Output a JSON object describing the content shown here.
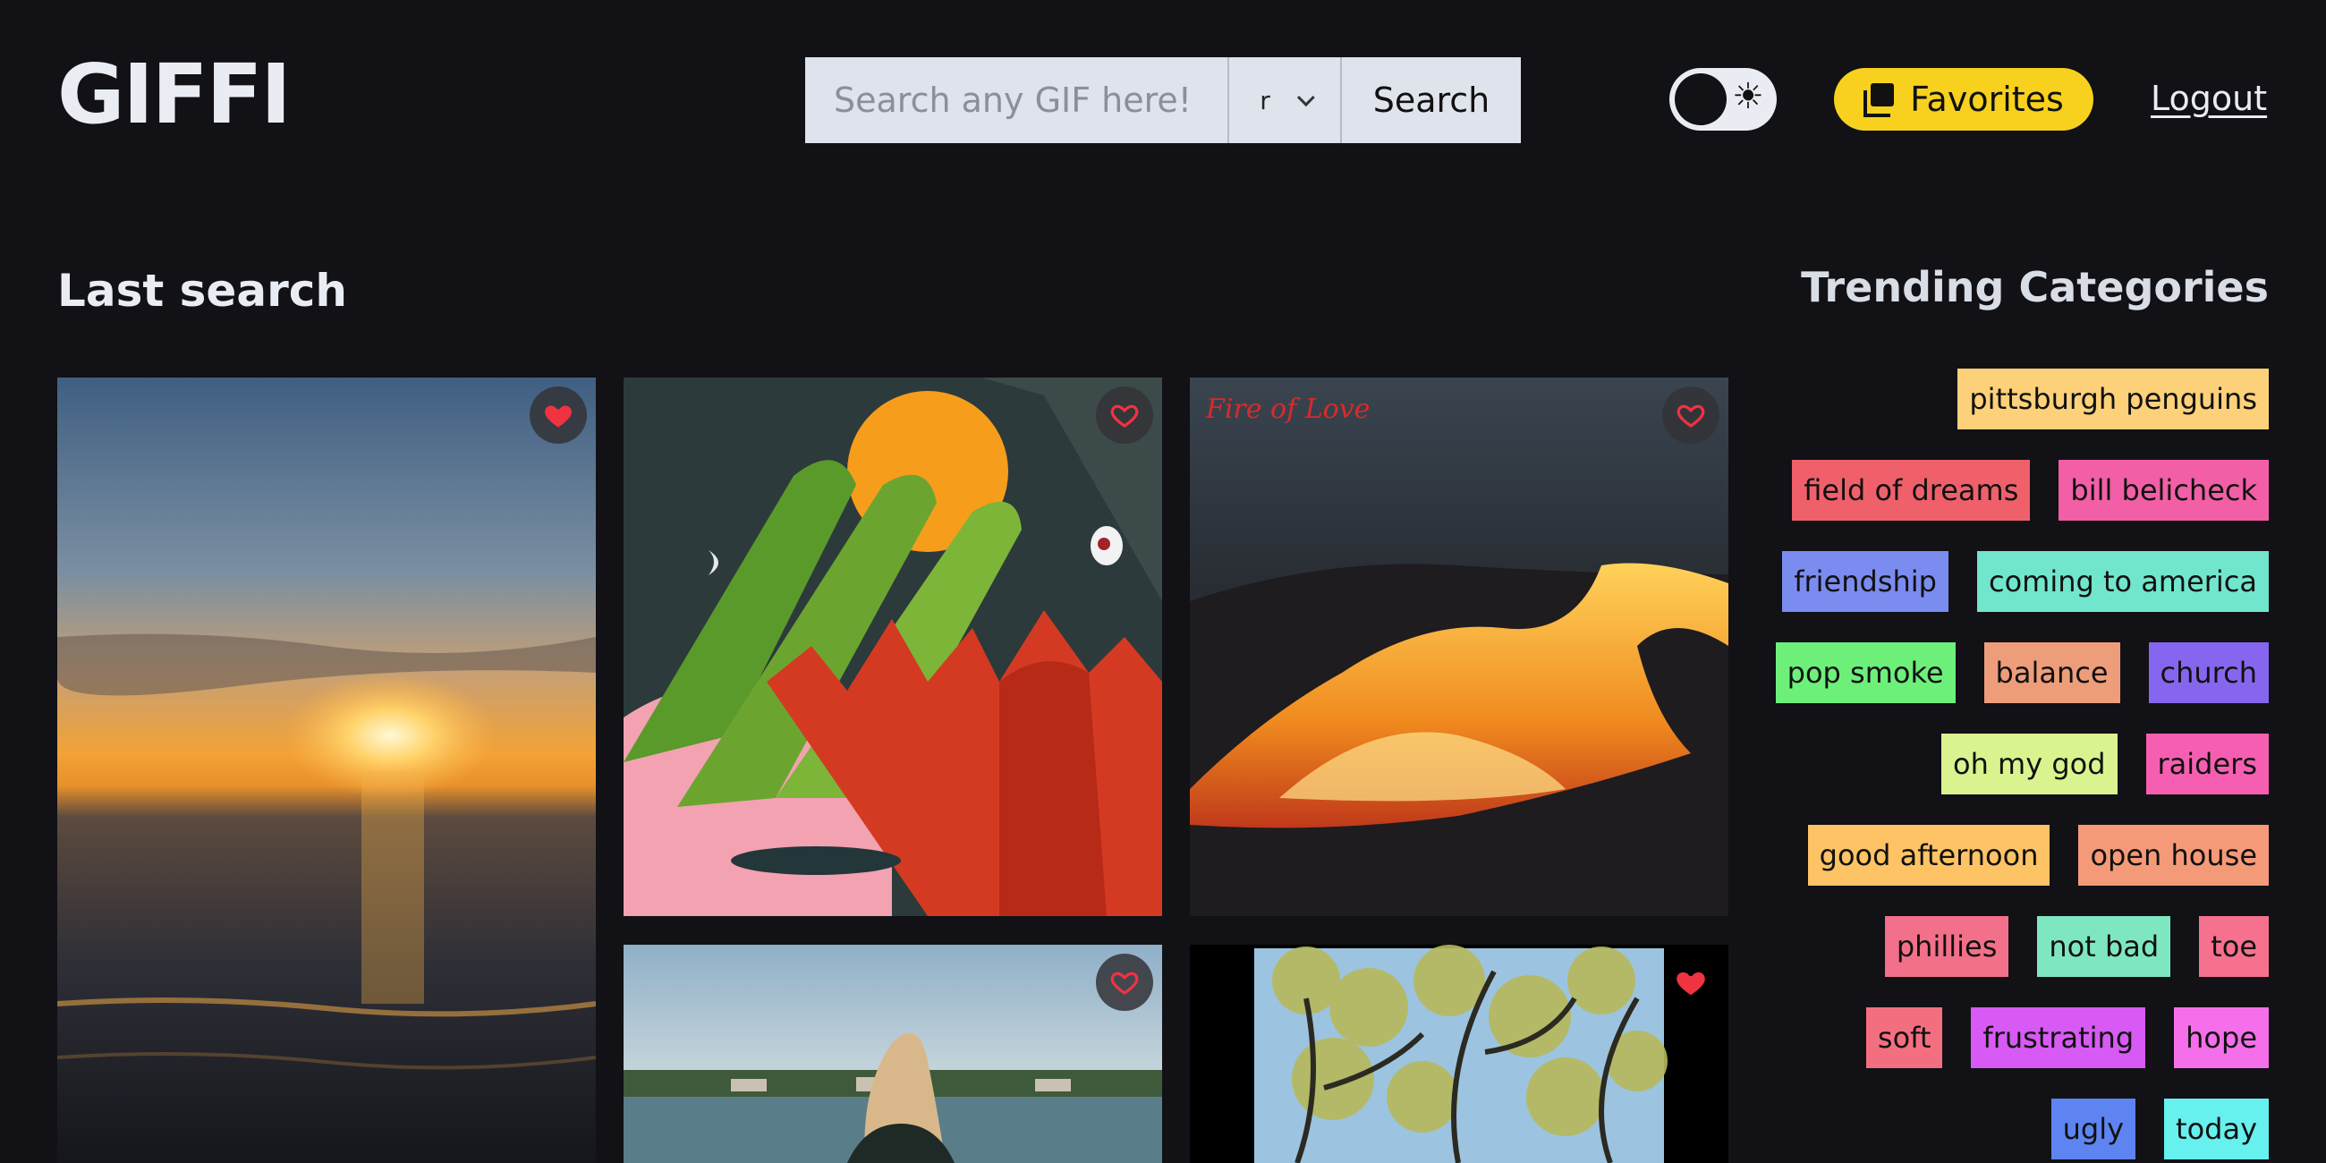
{
  "app": {
    "logo": "GIFFI"
  },
  "search": {
    "placeholder": "Search any GIF here!",
    "rating_value": "r",
    "button_label": "Search"
  },
  "header": {
    "favorites_label": "Favorites",
    "logout_label": "Logout"
  },
  "main": {
    "section_title": "Last search",
    "gifs": [
      {
        "name": "sunset-over-water",
        "favorited": true
      },
      {
        "name": "abstract-plant-illustration",
        "favorited": false
      },
      {
        "name": "fire-of-love-lava",
        "caption": "Fire of Love",
        "favorited": false
      },
      {
        "name": "woman-by-lake",
        "favorited": false
      },
      {
        "name": "tree-branches",
        "favorited": true
      }
    ]
  },
  "sidebar": {
    "title": "Trending Categories",
    "rows": [
      [
        {
          "label": "pittsburgh penguins",
          "color": "#fdd17a"
        }
      ],
      [
        {
          "label": "field of dreams",
          "color": "#f0606a"
        },
        {
          "label": "bill belicheck",
          "color": "#f25fa6"
        }
      ],
      [
        {
          "label": "friendship",
          "color": "#7b8cf0"
        },
        {
          "label": "coming to america",
          "color": "#71e6cd"
        }
      ],
      [
        {
          "label": "pop smoke",
          "color": "#6df07a"
        },
        {
          "label": "balance",
          "color": "#ee9d7a"
        },
        {
          "label": "church",
          "color": "#8666ee"
        }
      ],
      [
        {
          "label": "oh my god",
          "color": "#d9f48e"
        },
        {
          "label": "raiders",
          "color": "#f65fb1"
        }
      ],
      [
        {
          "label": "good afternoon",
          "color": "#fdc364"
        },
        {
          "label": "open house",
          "color": "#f59a78"
        }
      ],
      [
        {
          "label": "phillies",
          "color": "#f27089"
        },
        {
          "label": "not bad",
          "color": "#7ee7c1"
        },
        {
          "label": "toe",
          "color": "#f5718e"
        }
      ],
      [
        {
          "label": "soft",
          "color": "#f36f7f"
        },
        {
          "label": "frustrating",
          "color": "#d65af3"
        },
        {
          "label": "hope",
          "color": "#f46fe9"
        }
      ],
      [
        {
          "label": "ugly",
          "color": "#5e84f2"
        },
        {
          "label": "today",
          "color": "#66f0ee"
        }
      ]
    ]
  },
  "colors": {
    "background": "#111116",
    "accent": "#f7d11e",
    "heart": "#ef3340"
  }
}
